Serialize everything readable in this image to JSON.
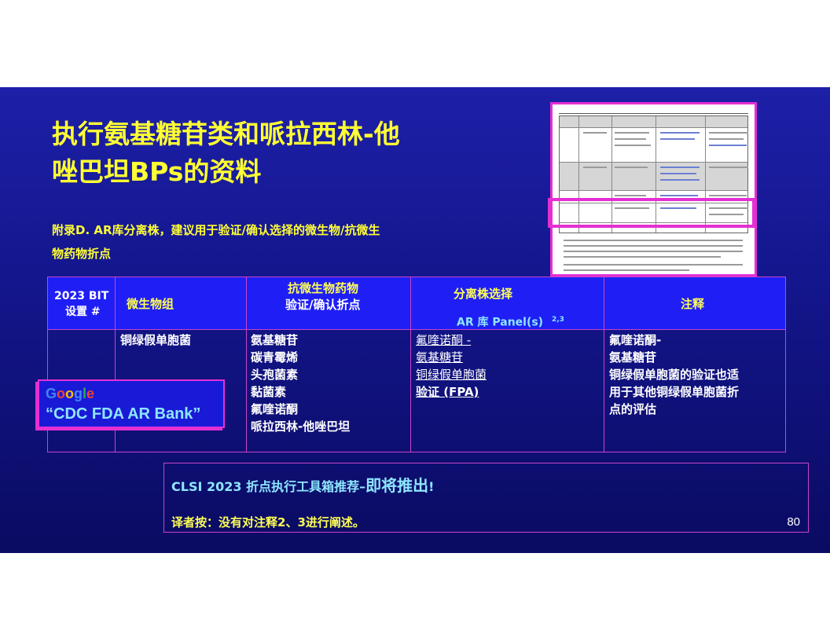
{
  "slide": {
    "title_line1": "执行氨基糖苷类和哌拉西林-他",
    "title_line2": "唑巴坦BPs的资料",
    "subtitle_line1": "附录D. AR库分离株，建议用于验证/确认选择的微生物/抗微生",
    "subtitle_line2": "物药物折点"
  },
  "table": {
    "headers": {
      "col1_line1": "2023 BIT",
      "col1_line2": "设置 #",
      "col2": "微生物组",
      "col3_line1": "抗微生物药物",
      "col3_line2": "验证/确认折点",
      "col4_line1": "分离株选择",
      "col4_line2": "AR 库 Panel(s)",
      "col4_sup": "2,3",
      "col5": "注释"
    },
    "row": {
      "organism": "铜绿假单胞菌",
      "drugs": [
        "氨基糖苷",
        "碳青霉烯",
        "头孢菌素",
        "黏菌素",
        "氟喹诺酮",
        "哌拉西林-他唑巴坦"
      ],
      "panels": [
        "氟喹诺酮 -",
        "氨基糖苷",
        "铜绿假单胞菌",
        "验证 (FPA)"
      ],
      "comments": [
        "氟喹诺酮-",
        "氨基糖苷",
        "铜绿假单胞菌的验证也适",
        "用于其他铜绿假单胞菌折",
        "点的评估"
      ]
    }
  },
  "google_callout": {
    "word": [
      "G",
      "o",
      "o",
      "g",
      "l",
      "e"
    ],
    "query": "“CDC FDA AR Bank”"
  },
  "note": {
    "line1_prefix": "CLSI 2023 折点执行工具箱推荐–",
    "line1_emph": "即将推出",
    "line1_suffix": "!",
    "line2": "译者按：没有对注释2、3进行阐述。",
    "page_number": "80"
  },
  "colors": {
    "title": "#ffff33",
    "header_fill": "#1f1ff5",
    "border": "#c844c8",
    "highlight": "#e52fd3"
  }
}
